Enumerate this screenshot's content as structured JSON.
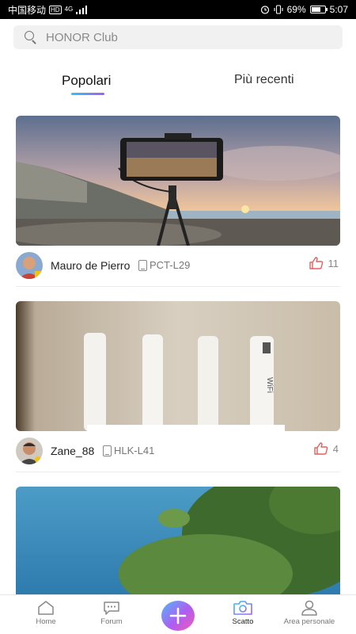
{
  "status_bar": {
    "carrier": "中国移动",
    "hd_badge": "HD",
    "network": "4G",
    "battery_percent": "69%",
    "battery_level": 0.69,
    "time": "5:07"
  },
  "search": {
    "placeholder": "HONOR Club",
    "icon": "search-icon"
  },
  "tabs": [
    {
      "label": "Popolari",
      "active": true
    },
    {
      "label": "Più recenti",
      "active": false
    }
  ],
  "posts": [
    {
      "author": "Mauro de Pierro",
      "device": "PCT-L29",
      "likes": "11",
      "photo_subject": "smartphone on tripod at seaside sunset"
    },
    {
      "author": "Zane_88",
      "device": "HLK-L41",
      "likes": "4",
      "photo_subject": "white wifi router with antennas"
    },
    {
      "author": "",
      "device": "",
      "likes": "",
      "photo_subject": "sea and pine trees"
    }
  ],
  "bottom_nav": [
    {
      "label": "Home",
      "icon": "home-icon"
    },
    {
      "label": "Forum",
      "icon": "chat-icon"
    },
    {
      "label": "",
      "icon": "plus-icon"
    },
    {
      "label": "Scatto",
      "icon": "camera-icon",
      "active": true
    },
    {
      "label": "Area personale",
      "icon": "person-icon"
    }
  ],
  "colors": {
    "accent_gradient_start": "#2ec5f5",
    "accent_gradient_end": "#a65df2",
    "like_icon": "#e0615d"
  }
}
